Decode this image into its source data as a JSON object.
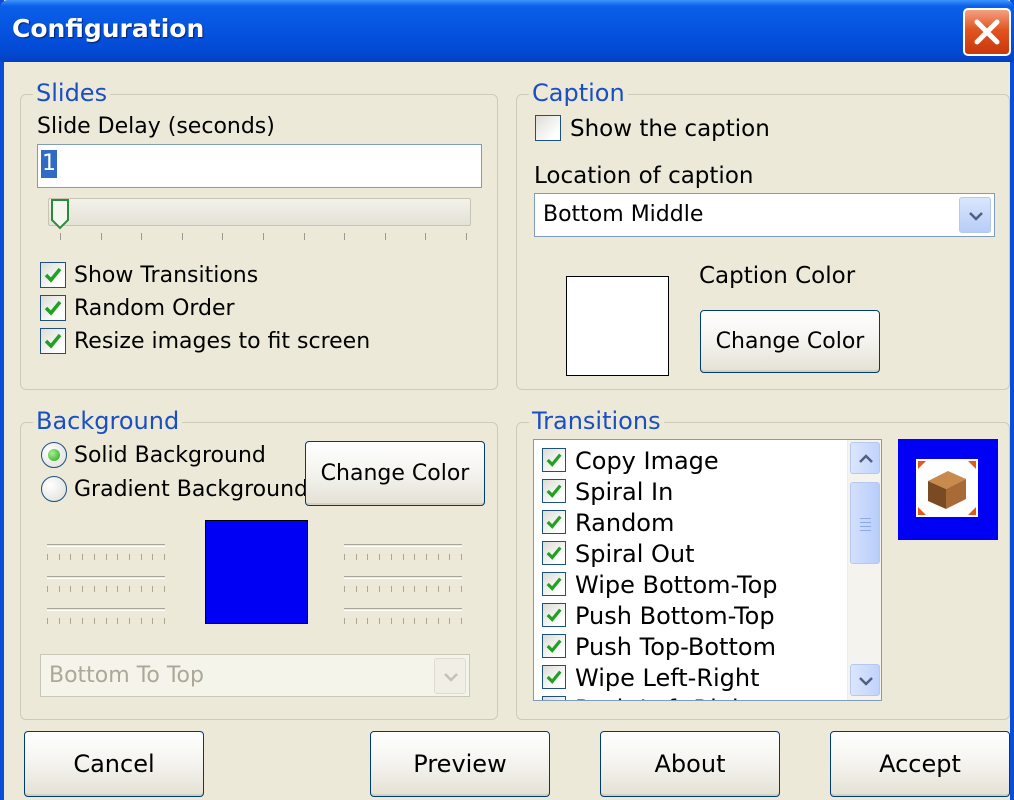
{
  "window": {
    "title": "Configuration"
  },
  "slides": {
    "legend": "Slides",
    "delay_label": "Slide Delay (seconds)",
    "delay_value": "1",
    "slider_value": 1,
    "checkboxes": [
      {
        "label": "Show Transitions",
        "checked": true
      },
      {
        "label": "Random Order",
        "checked": true
      },
      {
        "label": "Resize images to fit screen",
        "checked": true
      }
    ]
  },
  "caption": {
    "legend": "Caption",
    "show_label": "Show the caption",
    "show_checked": false,
    "location_label": "Location of caption",
    "location_value": "Bottom Middle",
    "color_label": "Caption Color",
    "color": "#ffffff",
    "change_color_label": "Change Color"
  },
  "background": {
    "legend": "Background",
    "radios": [
      {
        "label": "Solid Background",
        "selected": true
      },
      {
        "label": "Gradient Background",
        "selected": false
      }
    ],
    "change_color_label": "Change Color",
    "color": "#0000f5",
    "direction_value": "Bottom To Top"
  },
  "transitions": {
    "legend": "Transitions",
    "items": [
      {
        "label": "Copy Image",
        "checked": true
      },
      {
        "label": "Spiral In",
        "checked": true
      },
      {
        "label": "Random",
        "checked": true
      },
      {
        "label": "Spiral Out",
        "checked": true
      },
      {
        "label": "Wipe Bottom-Top",
        "checked": true
      },
      {
        "label": "Push Bottom-Top",
        "checked": true
      },
      {
        "label": "Push Top-Bottom",
        "checked": true
      },
      {
        "label": "Wipe Left-Right",
        "checked": true
      },
      {
        "label": "Push Left-Right",
        "checked": true
      }
    ]
  },
  "buttons": {
    "cancel": "Cancel",
    "preview": "Preview",
    "about": "About",
    "accept": "Accept"
  }
}
